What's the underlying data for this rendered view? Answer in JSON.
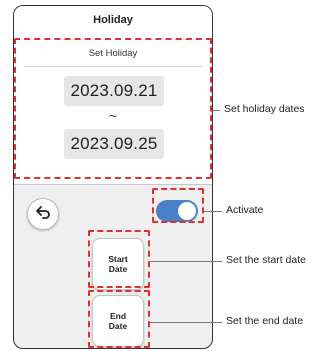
{
  "header": {
    "title": "Holiday"
  },
  "panel": {
    "title": "Set Holiday",
    "start_date": "2023.09.21",
    "separator": "~",
    "end_date": "2023.09.25"
  },
  "controls": {
    "back_icon": "back-arrow-icon",
    "activate_toggle": {
      "state": "on",
      "color": "#4a80c8"
    },
    "start_button_label": "Start\nDate",
    "end_button_label": "End\nDate"
  },
  "callouts": {
    "holiday_dates": "Set holiday dates",
    "activate": "Activate",
    "start_date": "Set the start date",
    "end_date": "Set the end date"
  },
  "colors": {
    "highlight": "#e03030",
    "toggle_on": "#4a80c8"
  }
}
